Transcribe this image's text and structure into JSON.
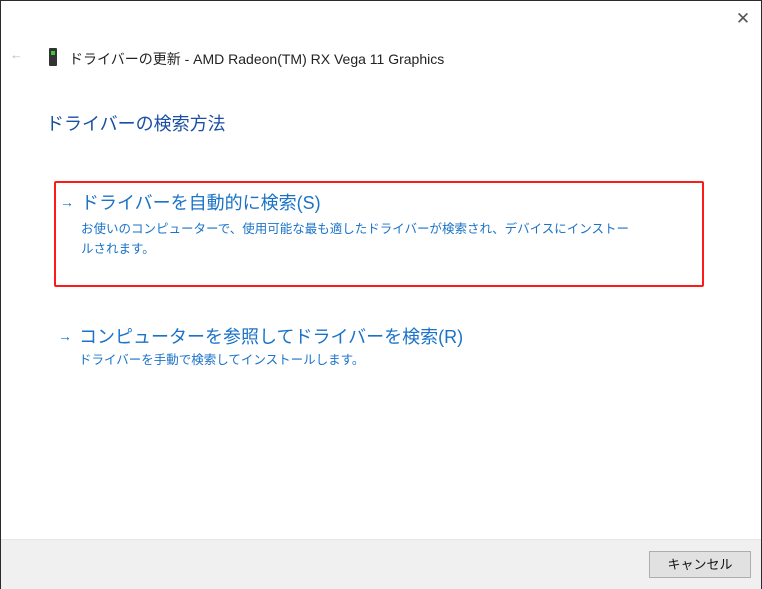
{
  "window": {
    "title": "ドライバーの更新 - AMD Radeon(TM) RX Vega 11 Graphics",
    "close_glyph": "✕",
    "back_glyph": "←"
  },
  "heading": "ドライバーの検索方法",
  "options": [
    {
      "arrow": "→",
      "title": "ドライバーを自動的に検索(S)",
      "description": "お使いのコンピューターで、使用可能な最も適したドライバーが検索され、デバイスにインストールされます。",
      "highlighted": true,
      "highlight_color": "#ff1a1a"
    },
    {
      "arrow": "→",
      "title": "コンピューターを参照してドライバーを検索(R)",
      "description": "ドライバーを手動で検索してインストールします。"
    }
  ],
  "footer": {
    "cancel_label": "キャンセル"
  },
  "colors": {
    "link": "#1a73c8",
    "heading": "#1a4fa3"
  }
}
